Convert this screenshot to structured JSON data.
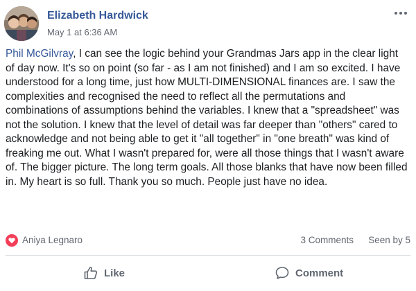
{
  "post": {
    "author": "Elizabeth Hardwick",
    "timestamp": "May 1 at 6:36 AM",
    "mention": "Phil McGilvray",
    "body": ", I can see the logic behind your Grandmas Jars app in the clear light of day now. It's so on point (so far - as I am not finished) and I am so excited. I have understood for a long time, just how MULTI-DIMENSIONAL finances are. I saw the complexities and recognised the need to reflect all the permutations and combinations of assumptions behind the variables. I knew that a \"spreadsheet\" was not the solution. I knew that the level of detail was far deeper than \"others\" cared to acknowledge and not being able to get it \"all together\" in \"one breath\" was kind of freaking me out. What I wasn't prepared for, were all those things that I wasn't aware of. The bigger picture. The long term goals. All those blanks that have now been filled in. My heart is so full. Thank you so much. People just have no idea."
  },
  "reactions": {
    "icon": "love-reaction-icon",
    "reactor": "Aniya Legnaro",
    "comments": "3 Comments",
    "seen_by": "Seen by 5"
  },
  "actions": {
    "like_label": "Like",
    "comment_label": "Comment"
  },
  "colors": {
    "link": "#365899",
    "text": "#1c1e21",
    "muted": "#616770",
    "love": "#f33e58",
    "divider": "#dadde1"
  }
}
